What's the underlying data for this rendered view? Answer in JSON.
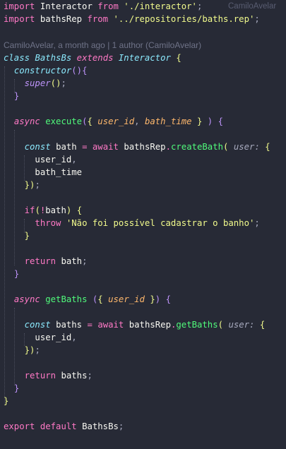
{
  "editor": {
    "language": "javascript",
    "theme": "dark",
    "colors": {
      "background": "#272a36",
      "keyword": "#ff79c6",
      "class_name": "#8be9fd",
      "function": "#50fa7b",
      "string": "#f1fa8c",
      "parameter": "#ffb86c",
      "constant": "#bd93f9",
      "comment": "#6f7388"
    },
    "inline_blame": "CamiloAvelar",
    "blame_header": "CamiloAvelar, a month ago | 1 author (CamiloAvelar)",
    "lines": [
      [
        "import",
        " Interactor ",
        "from",
        " ",
        "'./interactor'",
        ";"
      ],
      [
        "import",
        " bathsRep ",
        "from",
        " ",
        "'../repositories/baths.rep'",
        ";"
      ],
      [
        ""
      ],
      [
        "class",
        " ",
        "BathsBs",
        " ",
        "extends",
        " ",
        "Interactor",
        " ",
        "{"
      ],
      [
        "  ",
        "constructor",
        "(",
        ")",
        "{"
      ],
      [
        "    ",
        "super",
        "(",
        ")",
        ";"
      ],
      [
        "  ",
        "}"
      ],
      [
        ""
      ],
      [
        "  ",
        "async",
        " ",
        "execute",
        "(",
        "{",
        " ",
        "user_id",
        ", ",
        "bath_time",
        " ",
        "}",
        " ",
        ")",
        " ",
        "{"
      ],
      [
        ""
      ],
      [
        "    ",
        "const",
        " ",
        "bath",
        " ",
        "=",
        " ",
        "await",
        " ",
        "bathsRep",
        ".",
        "createBath",
        "(",
        " ",
        "user:",
        " ",
        "{"
      ],
      [
        "      ",
        "user_id",
        ","
      ],
      [
        "      ",
        "bath_time"
      ],
      [
        "    ",
        "}",
        ")",
        ";"
      ],
      [
        ""
      ],
      [
        "    ",
        "if",
        "(",
        "!",
        "bath",
        ")",
        " ",
        "{"
      ],
      [
        "      ",
        "throw",
        " ",
        "'Não foi possível cadastrar o banho'",
        ";"
      ],
      [
        "    ",
        "}"
      ],
      [
        ""
      ],
      [
        "    ",
        "return",
        " ",
        "bath",
        ";"
      ],
      [
        "  ",
        "}"
      ],
      [
        ""
      ],
      [
        "  ",
        "async",
        " ",
        "getBaths",
        " ",
        "(",
        "{",
        " ",
        "user_id",
        " ",
        "}",
        ")",
        " ",
        "{"
      ],
      [
        ""
      ],
      [
        "    ",
        "const",
        " ",
        "baths",
        " ",
        "=",
        " ",
        "await",
        " ",
        "bathsRep",
        ".",
        "getBaths",
        "(",
        " ",
        "user:",
        " ",
        "{"
      ],
      [
        "      ",
        "user_id",
        ","
      ],
      [
        "    ",
        "}",
        ")",
        ";"
      ],
      [
        ""
      ],
      [
        "    ",
        "return",
        " ",
        "baths",
        ";"
      ],
      [
        "  ",
        "}"
      ],
      [
        "}"
      ],
      [
        ""
      ],
      [
        "export",
        " ",
        "default",
        " ",
        "BathsBs",
        ";"
      ]
    ]
  }
}
